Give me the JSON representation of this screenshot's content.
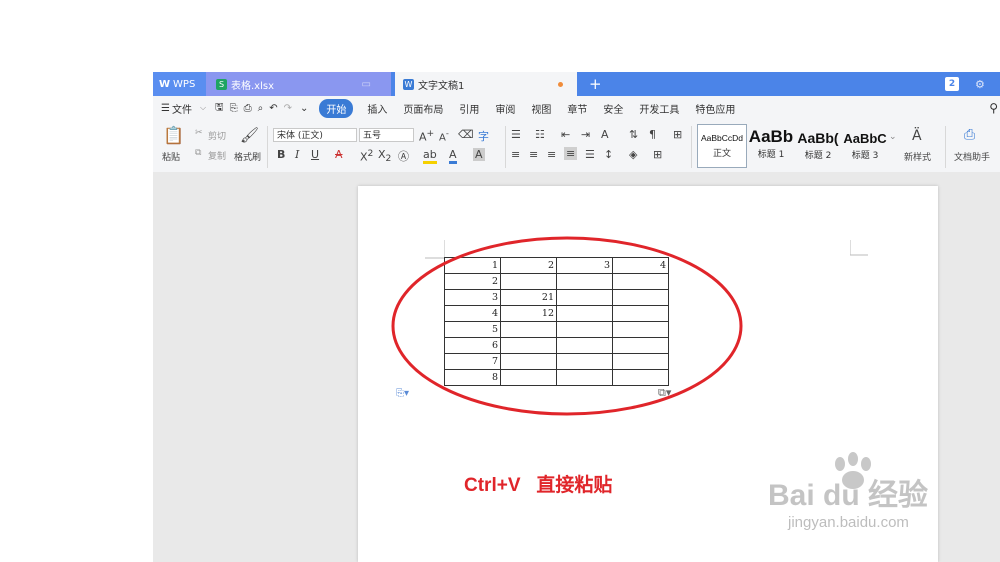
{
  "tabs": {
    "wps": "WPS",
    "spreadsheet": "表格.xlsx",
    "document": "文字文稿1",
    "add": "+",
    "counter": "2"
  },
  "menu": {
    "hamburger": "☰",
    "file": "文件",
    "items": [
      "开始",
      "插入",
      "页面布局",
      "引用",
      "审阅",
      "视图",
      "章节",
      "安全",
      "开发工具",
      "特色应用"
    ]
  },
  "ribbon": {
    "paste": "粘贴",
    "cut": "剪切",
    "copy": "复制",
    "format_painter": "格式刷",
    "font": "宋体 (正文)",
    "size": "五号",
    "styles": [
      {
        "preview": "AaBbCcDd",
        "label": "正文"
      },
      {
        "preview": "AaBb",
        "label": "标题 1"
      },
      {
        "preview": "AaBb(",
        "label": "标题 2"
      },
      {
        "preview": "AaBbC",
        "label": "标题 3"
      }
    ],
    "new_style": "新样式",
    "doc_helper": "文档助手"
  },
  "table": [
    [
      "1",
      "2",
      "3",
      "4"
    ],
    [
      "2",
      "",
      "",
      ""
    ],
    [
      "3",
      "21",
      "",
      ""
    ],
    [
      "4",
      "12",
      "",
      ""
    ],
    [
      "5",
      "",
      "",
      ""
    ],
    [
      "6",
      "",
      "",
      ""
    ],
    [
      "7",
      "",
      "",
      ""
    ],
    [
      "8",
      "",
      "",
      ""
    ]
  ],
  "annotation": {
    "text": "Ctrl+V   直接粘贴",
    "color": "#e0252a"
  },
  "watermark": {
    "brand": "Bai du 经验",
    "url": "jingyan.baidu.com"
  }
}
